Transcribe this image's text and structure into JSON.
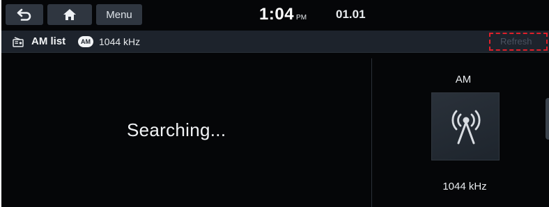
{
  "status_bar": {
    "back_icon": "back-arrow-icon",
    "home_icon": "home-icon",
    "menu_label": "Menu",
    "time": "1:04",
    "ampm": "PM",
    "date": "01.01"
  },
  "title_bar": {
    "icon": "radio-list-icon",
    "title": "AM list",
    "band_badge": "AM",
    "frequency": "1044 kHz",
    "refresh_label": "Refresh"
  },
  "main": {
    "status_text": "Searching..."
  },
  "station": {
    "band": "AM",
    "icon": "broadcast-antenna-icon",
    "frequency": "1044 kHz"
  },
  "colors": {
    "background": "#050608",
    "title_bar": "#1d232c",
    "nav_button": "#2f3640",
    "highlight": "#e0202a"
  }
}
